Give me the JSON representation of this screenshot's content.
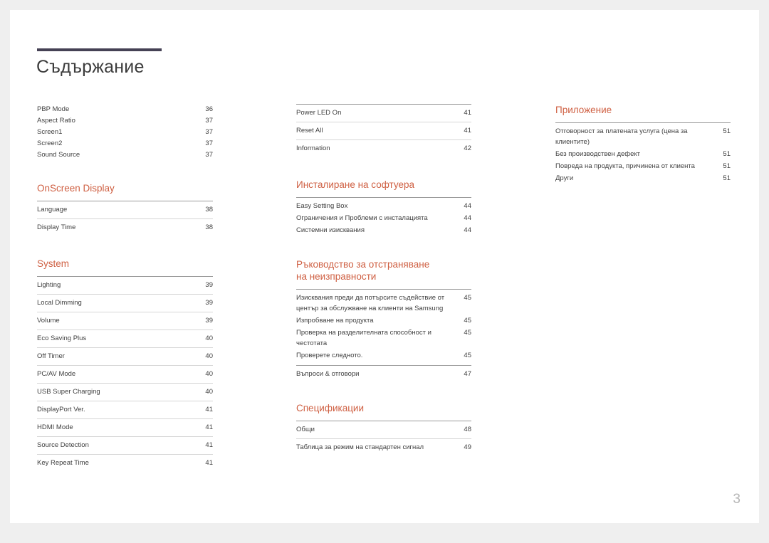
{
  "document": {
    "title": "Съдържание",
    "folio": "3",
    "accent_color": "#cf6043",
    "rule_color": "#454154",
    "text_color": "#3f3f3f"
  },
  "columns": [
    {
      "name": "column-left",
      "sections": [
        {
          "heading": "",
          "style": "plain",
          "entries": [
            {
              "label": "PBP Mode",
              "page": "36"
            },
            {
              "label": "Aspect Ratio",
              "page": "37"
            },
            {
              "label": "Screen1",
              "page": "37"
            },
            {
              "label": "Screen2",
              "page": "37"
            },
            {
              "label": "Sound Source",
              "page": "37"
            }
          ]
        },
        {
          "heading": "OnScreen Display",
          "style": "ruled",
          "entries": [
            {
              "label": "Language",
              "page": "38"
            },
            {
              "label": "Display Time",
              "page": "38"
            }
          ]
        },
        {
          "heading": "System",
          "style": "ruled",
          "entries": [
            {
              "label": "Lighting",
              "page": "39"
            },
            {
              "label": "Local Dimming",
              "page": "39"
            },
            {
              "label": "Volume",
              "page": "39"
            },
            {
              "label": "Eco Saving Plus",
              "page": "40"
            },
            {
              "label": "Off Timer",
              "page": "40"
            },
            {
              "label": "PC/AV Mode",
              "page": "40"
            },
            {
              "label": "USB Super Charging",
              "page": "40"
            },
            {
              "label": "DisplayPort Ver.",
              "page": "41"
            },
            {
              "label": "HDMI Mode",
              "page": "41"
            },
            {
              "label": "Source Detection",
              "page": "41"
            },
            {
              "label": "Key Repeat Time",
              "page": "41"
            }
          ]
        }
      ]
    },
    {
      "name": "column-middle",
      "sections": [
        {
          "heading": "",
          "style": "ruled",
          "entries": [
            {
              "label": "Power LED On",
              "page": "41"
            },
            {
              "label": "Reset All",
              "page": "41"
            },
            {
              "label": "Information",
              "page": "42"
            }
          ]
        },
        {
          "heading": "Инсталиране на софтуера",
          "style": "compact",
          "entries": [
            {
              "label": "Easy Setting Box",
              "page": "44"
            },
            {
              "label": "Ограничения и Проблеми с инсталацията",
              "page": "44"
            },
            {
              "label": "Системни изисквания",
              "page": "44"
            }
          ]
        },
        {
          "heading": "Ръководство за отстраняване\nна неизправности",
          "style": "compact",
          "entries": [
            {
              "label": "Изисквания преди да потърсите съдействие от център за обслужване на клиенти на Samsung",
              "page": "45",
              "wrap": true
            },
            {
              "label": "Изпробване на продукта",
              "page": "45"
            },
            {
              "label": "Проверка на разделителната способност и честотата",
              "page": "45",
              "wrap": true
            },
            {
              "label": "Проверете следното.",
              "page": "45"
            }
          ],
          "trailing": [
            {
              "label": "Въпроси & отговори",
              "page": "47"
            }
          ]
        },
        {
          "heading": "Спецификации",
          "style": "ruled",
          "entries": [
            {
              "label": "Общи",
              "page": "48"
            },
            {
              "label": "Таблица за режим на стандартен сигнал",
              "page": "49"
            }
          ]
        }
      ]
    },
    {
      "name": "column-right",
      "sections": [
        {
          "heading": "Приложение",
          "style": "compact",
          "entries": [
            {
              "label": "Отговорност за платената услуга (цена за клиентите)",
              "page": "51",
              "wrap": true
            },
            {
              "label": "Без производствен дефект",
              "page": "51"
            },
            {
              "label": "Повреда на продукта, причинена от клиента",
              "page": "51"
            },
            {
              "label": "Други",
              "page": "51"
            }
          ]
        }
      ]
    }
  ]
}
